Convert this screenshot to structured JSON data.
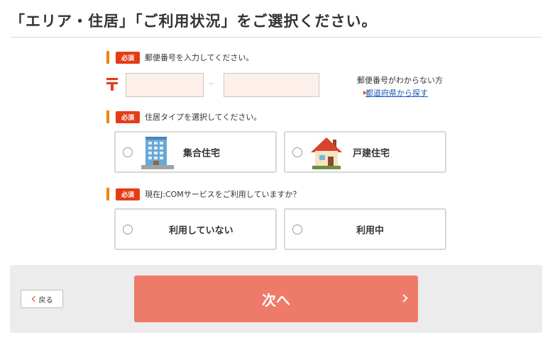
{
  "header": {
    "title": "「エリア・住居」「ご利用状況」をご選択ください。"
  },
  "postal": {
    "badge": "必須",
    "label": "郵便番号を入力してください。",
    "first_value": "",
    "second_value": "",
    "dash": "–",
    "help_text": "郵便番号がわからない方",
    "help_link": "都道府県から探す"
  },
  "housing": {
    "badge": "必須",
    "label": "住居タイプを選択してください。",
    "options": [
      {
        "label": "集合住宅",
        "icon": "apartment-building-icon"
      },
      {
        "label": "戸建住宅",
        "icon": "detached-house-icon"
      }
    ]
  },
  "usage": {
    "badge": "必須",
    "label": "現在J:COMサービスをご利用していますか？",
    "options": [
      {
        "label": "利用していない"
      },
      {
        "label": "利用中"
      }
    ]
  },
  "footer": {
    "back_label": "戻る",
    "next_label": "次へ"
  },
  "colors": {
    "accent_orange": "#f08300",
    "badge_red": "#e63c14",
    "next_button": "#ee7b69",
    "link_blue": "#1a5ab8"
  }
}
